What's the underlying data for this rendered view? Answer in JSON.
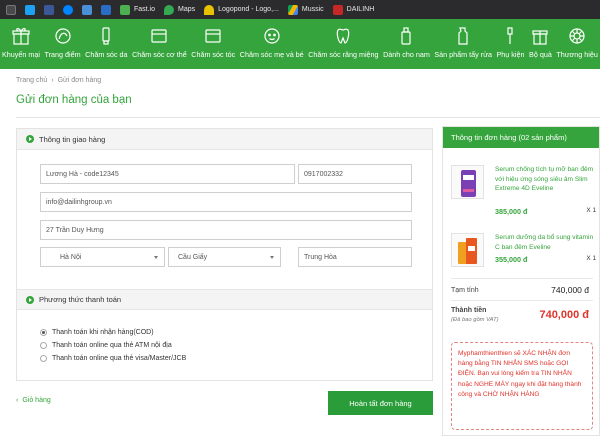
{
  "bookmarks": [
    {
      "label": "",
      "icon": "tab-icon",
      "color": "#3a3a3a"
    },
    {
      "label": "",
      "icon": "twitter-icon",
      "color": "#1da1f2"
    },
    {
      "label": "",
      "icon": "facebook-icon",
      "color": "#3b5998"
    },
    {
      "label": "",
      "icon": "messenger-icon",
      "color": "#0084ff"
    },
    {
      "label": "",
      "icon": "grid-icon",
      "color": "#4a90d9"
    },
    {
      "label": "",
      "icon": "flag-icon",
      "color": "#2b6cc4"
    },
    {
      "label": "Fast.io",
      "icon": "fastio-icon",
      "color": "#4caf50"
    },
    {
      "label": "Maps",
      "icon": "maps-icon",
      "color": "#34a853"
    },
    {
      "label": "Logopond - Logo,...",
      "icon": "logopond-icon",
      "color": "#e6c200"
    },
    {
      "label": "Mussic",
      "icon": "drive-icon",
      "color": "#0f9d58"
    },
    {
      "label": "DAILINH",
      "icon": "dailinh-icon",
      "color": "#c62828"
    }
  ],
  "categories": [
    {
      "label": "Khuyến mại",
      "icon": "gift-icon"
    },
    {
      "label": "Trang điểm",
      "icon": "makeup-icon"
    },
    {
      "label": "Chăm sóc da",
      "icon": "tube-icon"
    },
    {
      "label": "Chăm sóc cơ thể",
      "icon": "body-care-icon"
    },
    {
      "label": "Chăm sóc tóc",
      "icon": "hair-icon"
    },
    {
      "label": "Chăm sóc mẹ và bé",
      "icon": "baby-icon"
    },
    {
      "label": "Chăm sóc răng miệng",
      "icon": "tooth-icon"
    },
    {
      "label": "Dành cho nam",
      "icon": "bottle-icon"
    },
    {
      "label": "Sản phẩm tẩy rửa",
      "icon": "cleaner-icon"
    },
    {
      "label": "Phụ kiện",
      "icon": "brush-icon"
    },
    {
      "label": "Bộ quà",
      "icon": "gift-box-icon"
    },
    {
      "label": "Thương hiệu",
      "icon": "brand-icon"
    }
  ],
  "breadcrumb": {
    "home": "Trang chủ",
    "current": "Gửi đơn hàng"
  },
  "page_title": "Gửi đơn hàng của bạn",
  "delivery": {
    "heading": "Thông tin giao hàng",
    "name": "Lương Hà - code12345",
    "phone": "0917002332",
    "email": "info@dailinhgroup.vn",
    "address": "27 Trần Duy Hưng",
    "city": "Hà Nội",
    "district": "Cầu Giấy",
    "ward": "Trung Hòa"
  },
  "payment": {
    "heading": "Phương thức thanh toán",
    "options": [
      {
        "label": "Thanh toán khi nhận hàng(COD)",
        "selected": true
      },
      {
        "label": "Thanh toán online qua thẻ ATM nội địa",
        "selected": false
      },
      {
        "label": "Thanh toán online qua thẻ visa/Master/JCB",
        "selected": false
      }
    ]
  },
  "actions": {
    "back": "Giỏ hàng",
    "submit": "Hoàn tất đơn hàng"
  },
  "summary": {
    "heading": "Thông tin đơn hàng (02 sản phẩm)",
    "items": [
      {
        "name": "Serum chống tích tụ mỡ ban đêm với hiệu ứng sóng siêu âm Slim Extreme 4D Eveline",
        "price": "385,000 đ",
        "qty": "X 1"
      },
      {
        "name": "Serum dưỡng da bổ sung vitamin C ban đêm Eveline",
        "price": "355,000 đ",
        "qty": "X 1"
      }
    ],
    "subtotal_label": "Tạm tính",
    "subtotal": "740,000 đ",
    "total_label": "Thành tiền",
    "total_note": "(Đã bao gồm VAT)",
    "total": "740,000 đ",
    "notice": "Myphamthienthien sẽ XÁC NHẬN đơn hàng bằng TIN NHẮN SMS hoặc GỌI ĐIỆN. Bạn vui lòng kiểm tra TIN NHẮN hoặc NGHE MÁY ngay khi đặt hàng thành công và CHỜ NHẬN HÀNG"
  },
  "colors": {
    "brand_green": "#35a43c",
    "price_red": "#e0342b"
  }
}
